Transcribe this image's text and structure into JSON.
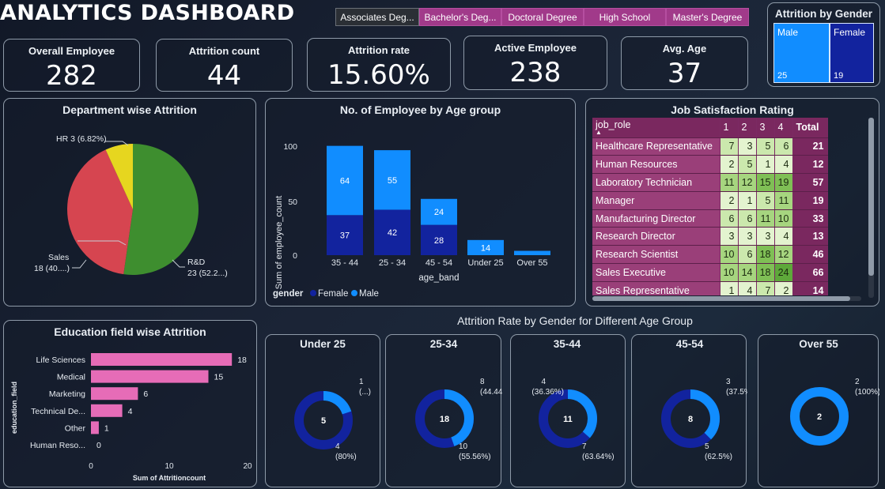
{
  "header": {
    "title": "ANALYTICS DASHBOARD",
    "slicers": [
      {
        "label": "Associates Deg...",
        "selected": true
      },
      {
        "label": "Bachelor's Deg...",
        "selected": false
      },
      {
        "label": "Doctoral Degree",
        "selected": false
      },
      {
        "label": "High School",
        "selected": false
      },
      {
        "label": "Master's Degree",
        "selected": false
      }
    ]
  },
  "kpis": [
    {
      "label": "Overall Employee",
      "value": "282"
    },
    {
      "label": "Attrition count",
      "value": "44"
    },
    {
      "label": "Attrition rate",
      "value": "15.60%"
    },
    {
      "label": "Active Employee",
      "value": "238"
    },
    {
      "label": "Avg. Age",
      "value": "37"
    }
  ],
  "gender_panel": {
    "title": "Attrition by Gender",
    "male": {
      "label": "Male",
      "value": "25"
    },
    "female": {
      "label": "Female",
      "value": "19"
    }
  },
  "dept_chart": {
    "title": "Department wise Attrition",
    "labels": {
      "hr": "HR 3 (6.82%)",
      "sales_1": "Sales",
      "sales_2": "18 (40....)",
      "rd_1": "R&D",
      "rd_2": "23 (52.2...)"
    }
  },
  "age_chart": {
    "title": "No. of Employee by Age group",
    "ylabel": "Sum of employee_count",
    "xlabel": "age_band",
    "legend_title": "gender",
    "legend_female": "Female",
    "legend_male": "Male",
    "yticks": [
      "100",
      "50",
      "0"
    ],
    "categories": [
      "35 - 44",
      "25 - 34",
      "45 - 54",
      "Under 25",
      "Over 55"
    ],
    "female_labels": [
      "37",
      "42",
      "28",
      "",
      ""
    ],
    "male_labels": [
      "64",
      "55",
      "24",
      "14",
      ""
    ]
  },
  "matrix": {
    "title": "Job Satisfaction Rating",
    "headers": [
      "job_role",
      "1",
      "2",
      "3",
      "4",
      "Total"
    ],
    "rows": [
      {
        "role": "Healthcare Representative",
        "v": [
          "7",
          "3",
          "5",
          "6"
        ],
        "total": "21"
      },
      {
        "role": "Human Resources",
        "v": [
          "2",
          "5",
          "1",
          "4"
        ],
        "total": "12"
      },
      {
        "role": "Laboratory Technician",
        "v": [
          "11",
          "12",
          "15",
          "19"
        ],
        "total": "57"
      },
      {
        "role": "Manager",
        "v": [
          "2",
          "1",
          "5",
          "11"
        ],
        "total": "19"
      },
      {
        "role": "Manufacturing Director",
        "v": [
          "6",
          "6",
          "11",
          "10"
        ],
        "total": "33"
      },
      {
        "role": "Research Director",
        "v": [
          "3",
          "3",
          "3",
          "4"
        ],
        "total": "13"
      },
      {
        "role": "Research Scientist",
        "v": [
          "10",
          "6",
          "18",
          "12"
        ],
        "total": "46"
      },
      {
        "role": "Sales Executive",
        "v": [
          "10",
          "14",
          "18",
          "24"
        ],
        "total": "66"
      },
      {
        "role": "Sales Representative",
        "v": [
          "1",
          "4",
          "7",
          "2"
        ],
        "total": "14"
      }
    ]
  },
  "edu_chart": {
    "title": "Education field wise Attrition",
    "ylabel": "education_field",
    "xlabel": "Sum of Attritioncount",
    "categories": [
      "Life Sciences",
      "Medical",
      "Marketing",
      "Technical De...",
      "Other",
      "Human Reso..."
    ],
    "value_labels": [
      "18",
      "15",
      "6",
      "4",
      "1",
      "0"
    ],
    "xticks": [
      "0",
      "10",
      "20"
    ]
  },
  "donuts_title": "Attrition Rate by Gender for Different Age Group",
  "donuts": [
    {
      "title": "Under 25",
      "total": "5",
      "male_l1": "1",
      "male_l2": "(...)",
      "female_l1": "4",
      "female_l2": "(80%)"
    },
    {
      "title": "25-34",
      "total": "18",
      "male_l1": "8",
      "male_l2": "(44.44%)",
      "female_l1": "10",
      "female_l2": "(55.56%)"
    },
    {
      "title": "35-44",
      "total": "11",
      "male_l1": "4",
      "male_l2": "(36.36%)",
      "female_l1": "7",
      "female_l2": "(63.64%)"
    },
    {
      "title": "45-54",
      "total": "8",
      "male_l1": "3",
      "male_l2": "(37.5%)",
      "female_l1": "5",
      "female_l2": "(62.5%)"
    },
    {
      "title": "Over 55",
      "total": "2",
      "male_l1": "2",
      "male_l2": "(100%)",
      "female_l1": "",
      "female_l2": ""
    }
  ],
  "colors": {
    "male": "#118dff",
    "female": "#12239e",
    "rd": "#3e8e2f",
    "sales": "#d64550",
    "hr": "#e6d61f",
    "edu_bar": "#e66cb7"
  },
  "chart_data": [
    {
      "type": "pie",
      "title": "Department wise Attrition",
      "categories": [
        "R&D",
        "Sales",
        "HR"
      ],
      "values": [
        23,
        18,
        3
      ]
    },
    {
      "type": "bar",
      "title": "No. of Employee by Age group",
      "xlabel": "age_band",
      "ylabel": "Sum of employee_count",
      "categories": [
        "35 - 44",
        "25 - 34",
        "45 - 54",
        "Under 25",
        "Over 55"
      ],
      "series": [
        {
          "name": "Female",
          "values": [
            37,
            42,
            28,
            0,
            0
          ]
        },
        {
          "name": "Male",
          "values": [
            64,
            55,
            24,
            14,
            4
          ]
        }
      ],
      "ylim": [
        0,
        110
      ],
      "stacked": true,
      "legend": "bottom-left"
    },
    {
      "type": "bar",
      "orientation": "horizontal",
      "title": "Education field wise Attrition",
      "xlabel": "Sum of Attritioncount",
      "ylabel": "education_field",
      "categories": [
        "Life Sciences",
        "Medical",
        "Marketing",
        "Technical De...",
        "Other",
        "Human Reso..."
      ],
      "values": [
        18,
        15,
        6,
        4,
        1,
        0
      ],
      "xlim": [
        0,
        20
      ]
    },
    {
      "type": "pie",
      "title": "Attrition by Gender",
      "categories": [
        "Male",
        "Female"
      ],
      "values": [
        25,
        19
      ]
    },
    {
      "type": "pie",
      "title": "Attrition Rate by Gender for Different Age Group",
      "groups": [
        "Under 25",
        "25-34",
        "35-44",
        "45-54",
        "Over 55"
      ],
      "series": [
        {
          "name": "Male",
          "values": [
            1,
            8,
            4,
            3,
            2
          ]
        },
        {
          "name": "Female",
          "values": [
            4,
            10,
            7,
            5,
            0
          ]
        }
      ]
    }
  ]
}
